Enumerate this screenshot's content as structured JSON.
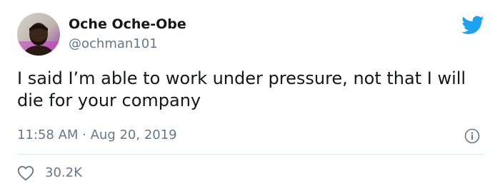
{
  "author": {
    "display_name": "Oche Oche-Obe",
    "handle": "@ochman101"
  },
  "tweet": {
    "text": "I said I’m able to work under pressure, not that I will die for your company",
    "timestamp": "11:58 AM · Aug 20, 2019"
  },
  "engagement": {
    "likes": "30.2K"
  },
  "icons": {
    "brand": "twitter-bird-icon",
    "info": "info-icon",
    "like": "heart-icon"
  },
  "colors": {
    "brand_blue": "#1da1f2",
    "secondary_text": "#657786",
    "primary_text": "#14171a",
    "divider": "#e1e8ed"
  }
}
